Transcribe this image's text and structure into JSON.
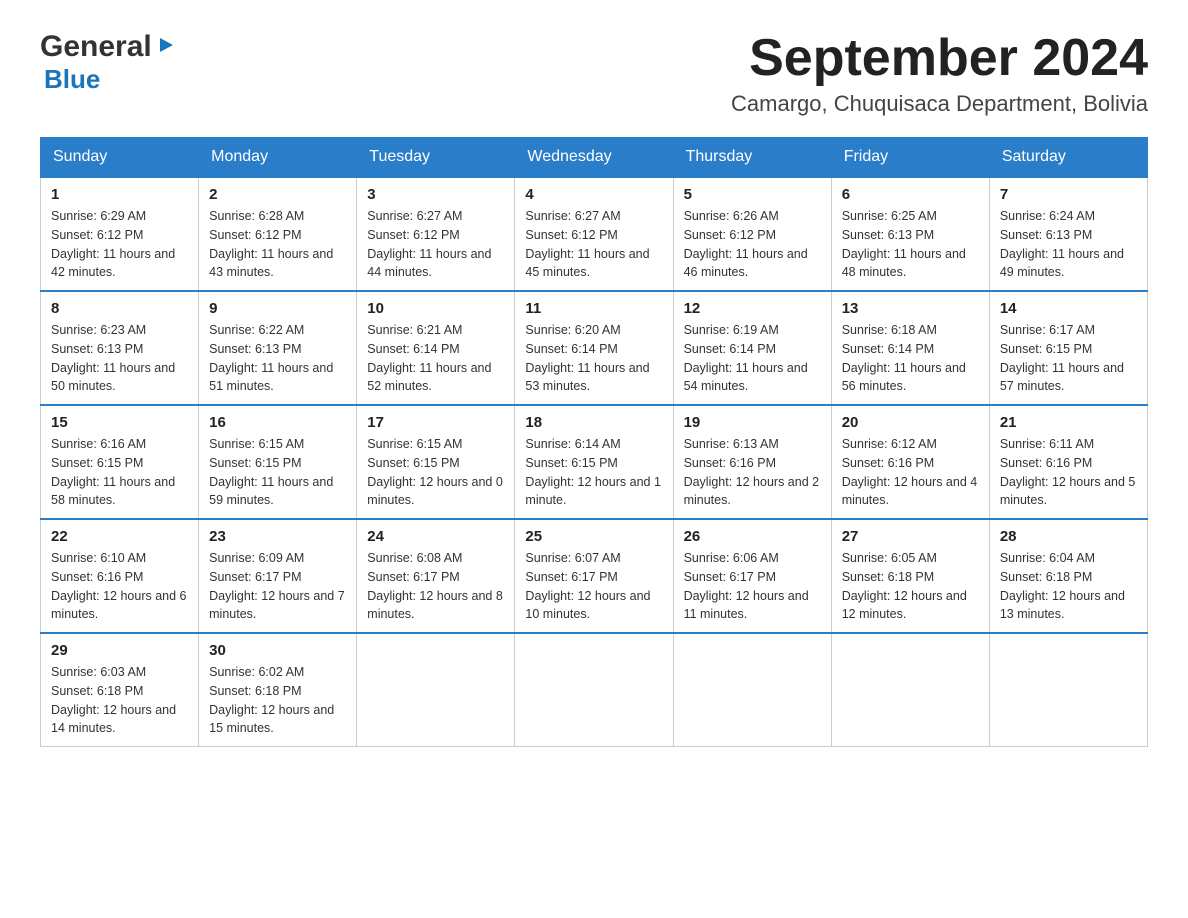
{
  "logo": {
    "general": "General",
    "blue": "Blue"
  },
  "title": {
    "month_year": "September 2024",
    "location": "Camargo, Chuquisaca Department, Bolivia"
  },
  "weekdays": [
    "Sunday",
    "Monday",
    "Tuesday",
    "Wednesday",
    "Thursday",
    "Friday",
    "Saturday"
  ],
  "weeks": [
    [
      {
        "day": "1",
        "sunrise": "6:29 AM",
        "sunset": "6:12 PM",
        "daylight": "11 hours and 42 minutes."
      },
      {
        "day": "2",
        "sunrise": "6:28 AM",
        "sunset": "6:12 PM",
        "daylight": "11 hours and 43 minutes."
      },
      {
        "day": "3",
        "sunrise": "6:27 AM",
        "sunset": "6:12 PM",
        "daylight": "11 hours and 44 minutes."
      },
      {
        "day": "4",
        "sunrise": "6:27 AM",
        "sunset": "6:12 PM",
        "daylight": "11 hours and 45 minutes."
      },
      {
        "day": "5",
        "sunrise": "6:26 AM",
        "sunset": "6:12 PM",
        "daylight": "11 hours and 46 minutes."
      },
      {
        "day": "6",
        "sunrise": "6:25 AM",
        "sunset": "6:13 PM",
        "daylight": "11 hours and 48 minutes."
      },
      {
        "day": "7",
        "sunrise": "6:24 AM",
        "sunset": "6:13 PM",
        "daylight": "11 hours and 49 minutes."
      }
    ],
    [
      {
        "day": "8",
        "sunrise": "6:23 AM",
        "sunset": "6:13 PM",
        "daylight": "11 hours and 50 minutes."
      },
      {
        "day": "9",
        "sunrise": "6:22 AM",
        "sunset": "6:13 PM",
        "daylight": "11 hours and 51 minutes."
      },
      {
        "day": "10",
        "sunrise": "6:21 AM",
        "sunset": "6:14 PM",
        "daylight": "11 hours and 52 minutes."
      },
      {
        "day": "11",
        "sunrise": "6:20 AM",
        "sunset": "6:14 PM",
        "daylight": "11 hours and 53 minutes."
      },
      {
        "day": "12",
        "sunrise": "6:19 AM",
        "sunset": "6:14 PM",
        "daylight": "11 hours and 54 minutes."
      },
      {
        "day": "13",
        "sunrise": "6:18 AM",
        "sunset": "6:14 PM",
        "daylight": "11 hours and 56 minutes."
      },
      {
        "day": "14",
        "sunrise": "6:17 AM",
        "sunset": "6:15 PM",
        "daylight": "11 hours and 57 minutes."
      }
    ],
    [
      {
        "day": "15",
        "sunrise": "6:16 AM",
        "sunset": "6:15 PM",
        "daylight": "11 hours and 58 minutes."
      },
      {
        "day": "16",
        "sunrise": "6:15 AM",
        "sunset": "6:15 PM",
        "daylight": "11 hours and 59 minutes."
      },
      {
        "day": "17",
        "sunrise": "6:15 AM",
        "sunset": "6:15 PM",
        "daylight": "12 hours and 0 minutes."
      },
      {
        "day": "18",
        "sunrise": "6:14 AM",
        "sunset": "6:15 PM",
        "daylight": "12 hours and 1 minute."
      },
      {
        "day": "19",
        "sunrise": "6:13 AM",
        "sunset": "6:16 PM",
        "daylight": "12 hours and 2 minutes."
      },
      {
        "day": "20",
        "sunrise": "6:12 AM",
        "sunset": "6:16 PM",
        "daylight": "12 hours and 4 minutes."
      },
      {
        "day": "21",
        "sunrise": "6:11 AM",
        "sunset": "6:16 PM",
        "daylight": "12 hours and 5 minutes."
      }
    ],
    [
      {
        "day": "22",
        "sunrise": "6:10 AM",
        "sunset": "6:16 PM",
        "daylight": "12 hours and 6 minutes."
      },
      {
        "day": "23",
        "sunrise": "6:09 AM",
        "sunset": "6:17 PM",
        "daylight": "12 hours and 7 minutes."
      },
      {
        "day": "24",
        "sunrise": "6:08 AM",
        "sunset": "6:17 PM",
        "daylight": "12 hours and 8 minutes."
      },
      {
        "day": "25",
        "sunrise": "6:07 AM",
        "sunset": "6:17 PM",
        "daylight": "12 hours and 10 minutes."
      },
      {
        "day": "26",
        "sunrise": "6:06 AM",
        "sunset": "6:17 PM",
        "daylight": "12 hours and 11 minutes."
      },
      {
        "day": "27",
        "sunrise": "6:05 AM",
        "sunset": "6:18 PM",
        "daylight": "12 hours and 12 minutes."
      },
      {
        "day": "28",
        "sunrise": "6:04 AM",
        "sunset": "6:18 PM",
        "daylight": "12 hours and 13 minutes."
      }
    ],
    [
      {
        "day": "29",
        "sunrise": "6:03 AM",
        "sunset": "6:18 PM",
        "daylight": "12 hours and 14 minutes."
      },
      {
        "day": "30",
        "sunrise": "6:02 AM",
        "sunset": "6:18 PM",
        "daylight": "12 hours and 15 minutes."
      },
      null,
      null,
      null,
      null,
      null
    ]
  ],
  "labels": {
    "sunrise": "Sunrise:",
    "sunset": "Sunset:",
    "daylight": "Daylight:"
  }
}
